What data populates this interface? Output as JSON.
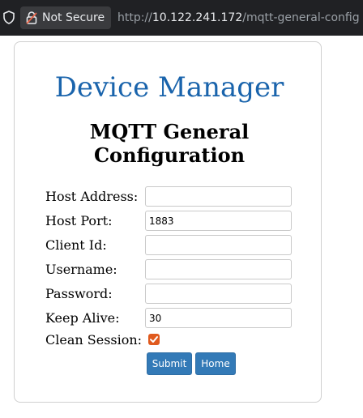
{
  "browser": {
    "security_label": "Not Secure",
    "url_prefix": "http://",
    "url_host": "10.122.241.172",
    "url_path": "/mqtt-general-config"
  },
  "page": {
    "brand": "Device Manager",
    "title_line1": "MQTT General",
    "title_line2": "Configuration"
  },
  "form": {
    "fields": [
      {
        "label": "Host Address:",
        "value": ""
      },
      {
        "label": "Host Port:",
        "value": "1883"
      },
      {
        "label": "Client Id:",
        "value": ""
      },
      {
        "label": "Username:",
        "value": ""
      },
      {
        "label": "Password:",
        "value": ""
      },
      {
        "label": "Keep Alive:",
        "value": "30"
      }
    ],
    "clean_session": {
      "label": "Clean Session:",
      "checked": true
    },
    "submit_label": "Submit",
    "home_label": "Home"
  },
  "colors": {
    "brand": "#1a64ac",
    "button": "#337ab7",
    "checkbox": "#e05a1e"
  }
}
